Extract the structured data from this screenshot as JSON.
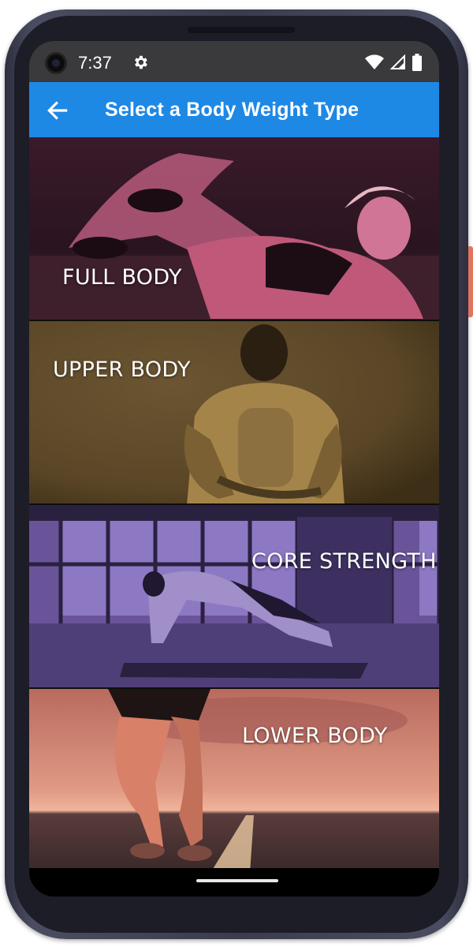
{
  "status_bar": {
    "time": "7:37",
    "icons": [
      "gear-icon",
      "wifi-icon",
      "signal-icon",
      "battery-icon"
    ]
  },
  "app_bar": {
    "title": "Select a Body Weight Type",
    "back_icon": "arrow-left-icon",
    "color": "#1e88e5"
  },
  "categories": [
    {
      "label": "FULL BODY",
      "tint": "#c0587a"
    },
    {
      "label": "UPPER BODY",
      "tint": "#a5844a"
    },
    {
      "label": "CORE STRENGTH",
      "tint": "#7b5fb3"
    },
    {
      "label": "LOWER BODY",
      "tint": "#d98068"
    }
  ]
}
